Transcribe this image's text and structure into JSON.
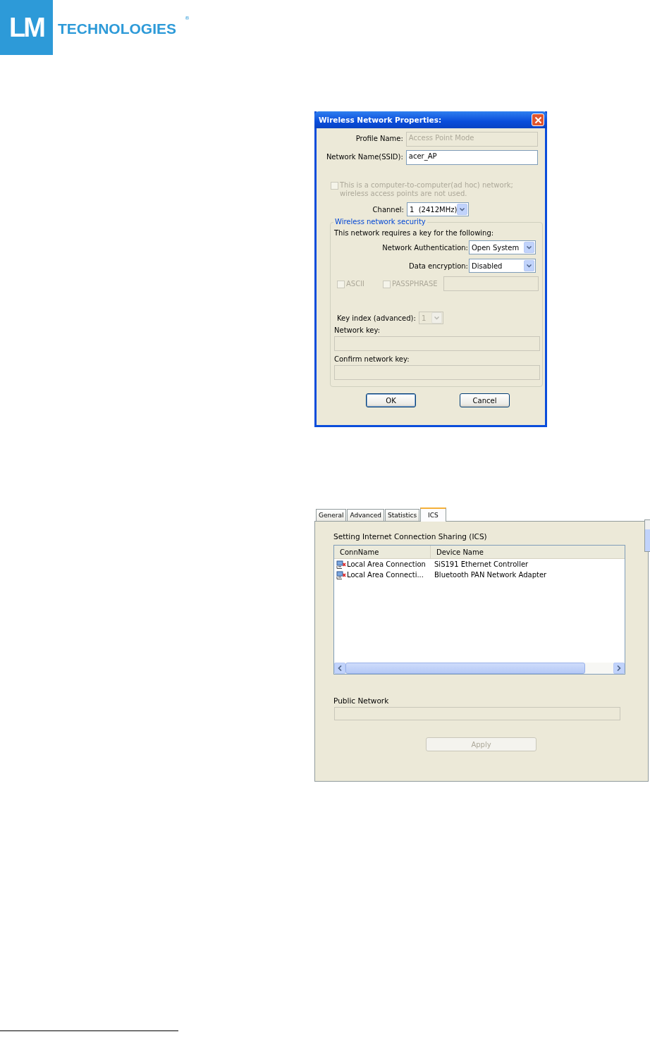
{
  "logo": {
    "mark": "LM",
    "name": "TECHNOLOGIES",
    "registered": "®"
  },
  "dialog": {
    "title": "Wireless Network Properties:",
    "fields": [
      {
        "label": "Profile Name:",
        "value": "Access Point Mode",
        "disabled": true
      },
      {
        "label": "Network Name(SSID):",
        "value": "acer_AP",
        "disabled": false
      }
    ],
    "adhoc": {
      "label": "This is a computer-to-computer(ad hoc) network; wireless access points are not used.",
      "checked": false,
      "disabled": true
    },
    "channel": {
      "label": "Channel:",
      "value": "1  (2412MHz)"
    },
    "security": {
      "legend": "Wireless network security",
      "intro": "This network requires a key for the following:",
      "authentication": {
        "label": "Network Authentication:",
        "value": "Open System"
      },
      "encryption": {
        "label": "Data encryption:",
        "value": "Disabled"
      },
      "checkboxes": [
        {
          "label": "ASCII",
          "checked": false,
          "disabled": true
        },
        {
          "label": "PASSPHRASE",
          "checked": false,
          "disabled": true
        }
      ],
      "key_index": {
        "label": "Key index (advanced):",
        "value": "1",
        "disabled": true
      },
      "network_key": {
        "label": "Network key:"
      },
      "confirm_key": {
        "label": "Confirm network key:"
      }
    },
    "buttons": [
      "OK",
      "Cancel"
    ]
  },
  "ics": {
    "tabs": [
      {
        "label": "General",
        "selected": false
      },
      {
        "label": "Advanced",
        "selected": false
      },
      {
        "label": "Statistics",
        "selected": false
      },
      {
        "label": "ICS",
        "selected": true
      }
    ],
    "heading": "Setting Internet Connection Sharing (ICS)",
    "columns": [
      "ConnName",
      "Device Name"
    ],
    "rows": [
      {
        "conn_name": "Local Area Connection",
        "device_name": "SiS191 Ethernet Controller"
      },
      {
        "conn_name": "Local Area Connecti...",
        "device_name": "Bluetooth PAN Network Adapter"
      }
    ],
    "public_network": {
      "label": "Public Network"
    },
    "apply": {
      "label": "Apply",
      "disabled": true
    }
  }
}
